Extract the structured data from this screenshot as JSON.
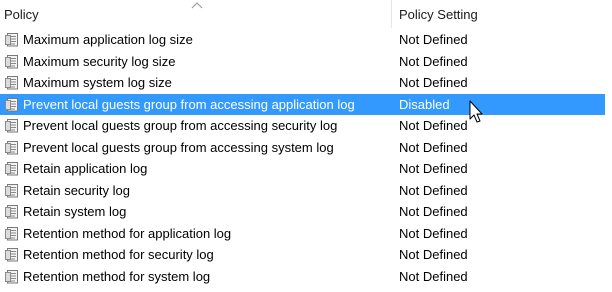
{
  "columns": {
    "policy": "Policy",
    "policy_setting": "Policy Setting"
  },
  "header": {
    "sort_indicator": "up-arrow"
  },
  "rows": [
    {
      "policy": "Maximum application log size",
      "setting": "Not Defined",
      "selected": false
    },
    {
      "policy": "Maximum security log size",
      "setting": "Not Defined",
      "selected": false
    },
    {
      "policy": "Maximum system log size",
      "setting": "Not Defined",
      "selected": false
    },
    {
      "policy": "Prevent local guests group from accessing application log",
      "setting": "Disabled",
      "selected": true
    },
    {
      "policy": "Prevent local guests group from accessing security log",
      "setting": "Not Defined",
      "selected": false
    },
    {
      "policy": "Prevent local guests group from accessing system log",
      "setting": "Not Defined",
      "selected": false
    },
    {
      "policy": "Retain application log",
      "setting": "Not Defined",
      "selected": false
    },
    {
      "policy": "Retain security log",
      "setting": "Not Defined",
      "selected": false
    },
    {
      "policy": "Retain system log",
      "setting": "Not Defined",
      "selected": false
    },
    {
      "policy": "Retention method for application log",
      "setting": "Not Defined",
      "selected": false
    },
    {
      "policy": "Retention method for security log",
      "setting": "Not Defined",
      "selected": false
    },
    {
      "policy": "Retention method for system log",
      "setting": "Not Defined",
      "selected": false
    }
  ],
  "colors": {
    "selection": "#3399ff",
    "selection_text": "#ffffff",
    "text": "#000000",
    "divider": "#e5e5e5"
  },
  "icons": {
    "row_icon": "policy-document-icon",
    "cursor": "mouse-pointer-icon"
  }
}
